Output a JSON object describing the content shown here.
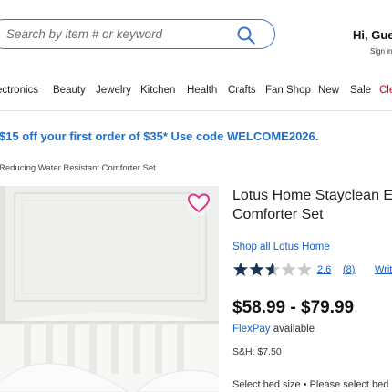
{
  "search": {
    "placeholder": "Search by item # or keyword"
  },
  "account": {
    "greeting": "Hi, Gue",
    "sign_in": "Sign in"
  },
  "nav": {
    "items": [
      "ectronics",
      "Beauty",
      "Jewelry",
      "Kitchen",
      "Health",
      "Crafts",
      "Fan Shop",
      "New",
      "Sale",
      "Cle"
    ]
  },
  "promo": {
    "text": "$15 off your first order of $35* Use code WELCOME2026."
  },
  "breadcrumb": {
    "text": "Reducing Water Resistant Comforter Set"
  },
  "product": {
    "title_line1": "Lotus Home Stayclean E",
    "title_line2": "Comforter Set",
    "shop_brand": "Shop all Lotus Home",
    "rating": 2.6,
    "rating_text": "2.6",
    "review_count": "(8)",
    "write_review": "Writ",
    "price": "$58.99 - $79.99",
    "flexpay": "FlexPay",
    "flexpay_suffix": " available",
    "shipping": "S&H: $7.50",
    "bed_size": "Select bed size • Please select bed"
  },
  "colors": {
    "accent_blue": "#1a5fc4",
    "promo_blue": "#1f6fd1",
    "clearance_red": "#d0021b",
    "star_fill": "#1b3556",
    "star_empty": "#c8c8c8",
    "heart_pink": "#e0338f"
  },
  "icons": {
    "search": "search-icon",
    "wishlist": "heart-icon",
    "rating": "star-icon"
  }
}
